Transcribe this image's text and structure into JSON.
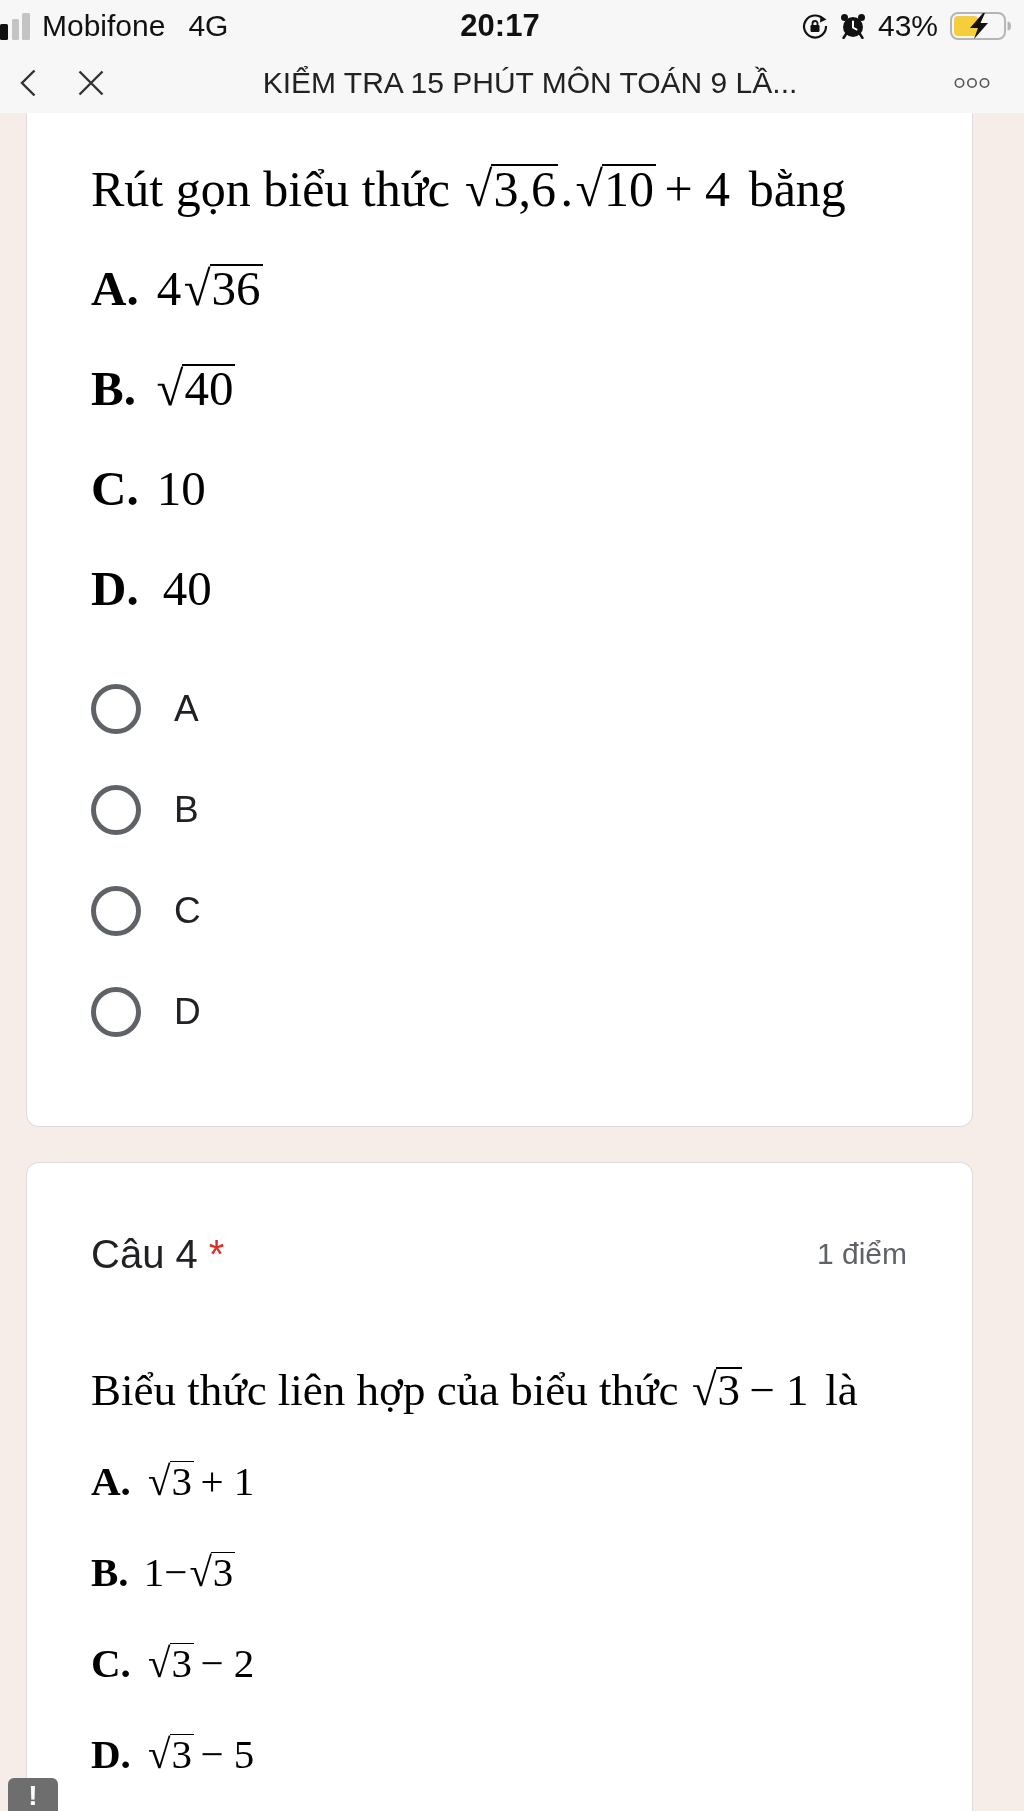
{
  "status_bar": {
    "carrier": "Mobifone",
    "network": "4G",
    "time": "20:17",
    "battery_percent": "43%"
  },
  "nav_bar": {
    "title": "KIỂM TRA 15 PHÚT MÔN TOÁN 9 LẦ..."
  },
  "questions": [
    {
      "statement": [
        {
          "kind": "text",
          "text": "Rút gọn biểu thức "
        },
        {
          "kind": "root",
          "sign": "√",
          "radicand": "3,6"
        },
        {
          "kind": "text",
          "text": "."
        },
        {
          "kind": "root",
          "sign": "√",
          "radicand": "10"
        },
        {
          "kind": "math",
          "text": "+ 4"
        },
        {
          "kind": "text",
          "text": " bằng"
        }
      ],
      "answers": [
        {
          "letter": "A.",
          "expr": [
            {
              "kind": "text",
              "text": "4"
            },
            {
              "kind": "root",
              "sign": "√",
              "radicand": "36"
            }
          ]
        },
        {
          "letter": "B.",
          "expr": [
            {
              "kind": "root",
              "sign": "√",
              "radicand": "40"
            }
          ]
        },
        {
          "letter": "C.",
          "expr": [
            {
              "kind": "text",
              "text": "10"
            }
          ]
        },
        {
          "letter": "D.",
          "expr": [
            {
              "kind": "math",
              "text": "40"
            }
          ]
        }
      ],
      "options": [
        {
          "label": "A",
          "selected": false
        },
        {
          "label": "B",
          "selected": false
        },
        {
          "label": "C",
          "selected": false
        },
        {
          "label": "D",
          "selected": false
        }
      ]
    },
    {
      "title": "Câu 4",
      "required_mark": "*",
      "points": "1 điểm",
      "statement": [
        {
          "kind": "text",
          "text": "Biểu thức liên hợp của biểu thức "
        },
        {
          "kind": "root",
          "sign": "√",
          "radicand": "3"
        },
        {
          "kind": "math",
          "text": "− 1"
        },
        {
          "kind": "text",
          "text": " là"
        }
      ],
      "answers": [
        {
          "letter": "A.",
          "expr": [
            {
              "kind": "root",
              "sign": "√",
              "radicand": "3"
            },
            {
              "kind": "math",
              "text": "+ 1"
            }
          ]
        },
        {
          "letter": "B.",
          "expr": [
            {
              "kind": "text",
              "text": "1−"
            },
            {
              "kind": "root",
              "sign": "√",
              "radicand": "3"
            }
          ]
        },
        {
          "letter": "C.",
          "expr": [
            {
              "kind": "root",
              "sign": "√",
              "radicand": "3"
            },
            {
              "kind": "math",
              "text": "− 2"
            }
          ]
        },
        {
          "letter": "D.",
          "expr": [
            {
              "kind": "root",
              "sign": "√",
              "radicand": "3"
            },
            {
              "kind": "math",
              "text": "− 5"
            }
          ]
        }
      ]
    }
  ],
  "report_button": {
    "label": "!"
  }
}
